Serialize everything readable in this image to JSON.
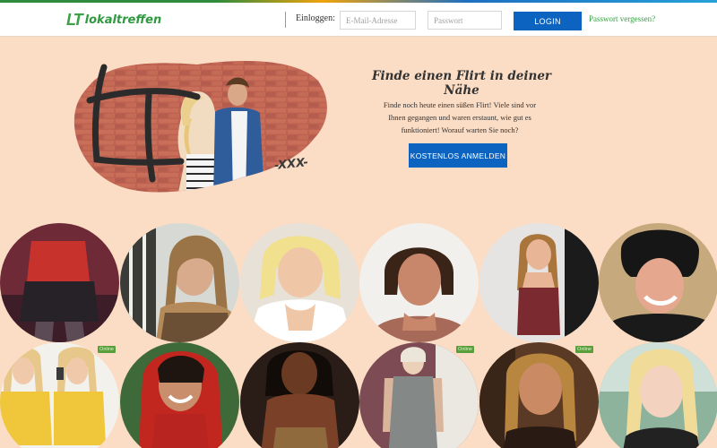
{
  "header": {
    "logo_mark": "LT",
    "logo_text": "lokaltreffen",
    "login_label": "Einloggen:",
    "email_placeholder": "E-Mail-Adresse",
    "password_placeholder": "Passwort",
    "login_button": "LOGIN",
    "forgot_link": "Passwort vergessen?"
  },
  "hero": {
    "title": "Finde einen Flirt in deiner Nähe",
    "text": "Finde noch heute einen süßen Flirt! Viele sind vor Ihnen gegangen und waren erstaunt, wie gut es funktioniert! Worauf warten Sie noch?",
    "cta": "KOSTENLOS ANMELDEN",
    "signature": "-XXX-"
  },
  "profiles": {
    "online_badge": "Online",
    "items": [
      {
        "name": "profile-1",
        "online": false
      },
      {
        "name": "profile-2",
        "online": false
      },
      {
        "name": "profile-3",
        "online": false
      },
      {
        "name": "profile-4",
        "online": false
      },
      {
        "name": "profile-5",
        "online": false
      },
      {
        "name": "profile-6",
        "online": false
      },
      {
        "name": "profile-7",
        "online": true
      },
      {
        "name": "profile-8",
        "online": false
      },
      {
        "name": "profile-9",
        "online": false
      },
      {
        "name": "profile-10",
        "online": true
      },
      {
        "name": "profile-11",
        "online": true
      },
      {
        "name": "profile-12",
        "online": false
      }
    ]
  },
  "colors": {
    "page_bg": "#fbdcc4",
    "brand_green": "#3aa147",
    "button_blue": "#0d64c0",
    "online_green": "#5a9e3c"
  }
}
